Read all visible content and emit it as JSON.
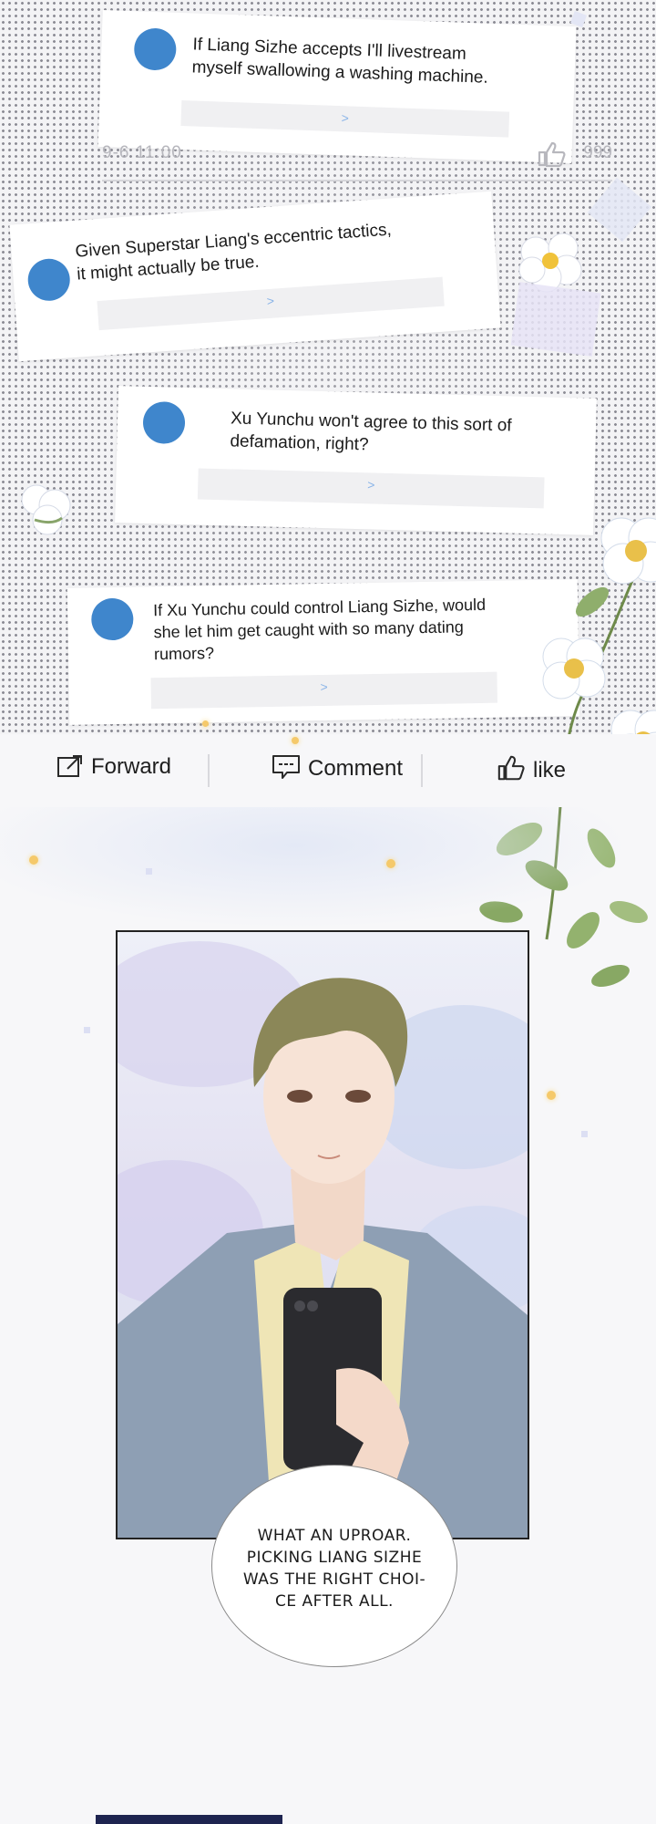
{
  "comments": [
    {
      "text_lines": [
        "If Liang Sizhe accepts I'll livestream",
        "myself swallowing a washing machine."
      ],
      "link": ">"
    },
    {
      "text_lines": [
        "Given Superstar Liang's eccentric tactics,",
        "it might actually be true."
      ],
      "link": ">"
    },
    {
      "text_lines": [
        "Xu Yunchu won't agree to this sort of",
        "defamation, right?"
      ],
      "link": ">"
    },
    {
      "text_lines": [
        "If Xu Yunchu could control Liang Sizhe, would",
        "she let him get caught with so many dating",
        "rumors?"
      ],
      "link": ">"
    }
  ],
  "meta": {
    "time": "9-6 11:00",
    "likes": "999"
  },
  "actions": {
    "forward": "Forward",
    "comment": "Comment",
    "like": "like"
  },
  "speech_bubble": {
    "lines": [
      "WHAT AN UPROAR.",
      "PICKING LIANG SIZHE",
      "WAS THE RIGHT CHOI-",
      "CE AFTER ALL."
    ]
  },
  "colors": {
    "avatar": "#3f86cc",
    "halftone": "#8c8c95",
    "link": "#8ab4e8"
  }
}
